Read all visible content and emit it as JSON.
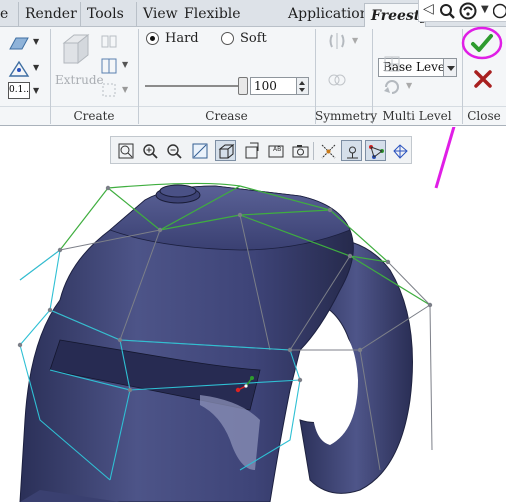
{
  "tabs": [
    {
      "label": "e"
    },
    {
      "label": "Render"
    },
    {
      "label": "Tools"
    },
    {
      "label": "View"
    },
    {
      "label": "Flexible Modeling"
    },
    {
      "label": "Applications"
    },
    {
      "label": "Freestyle"
    }
  ],
  "ribbon": {
    "extrude_label": "Extrude",
    "small_field": "0.1..",
    "hard_label": "Hard",
    "soft_label": "Soft",
    "crease_value": "100",
    "base_level": "Base Level",
    "groups": {
      "create": "Create",
      "crease": "Crease",
      "symmetry": "Symmetry",
      "multi_level": "Multi Level",
      "close": "Close"
    }
  },
  "icons": {
    "ok": "checkmark-icon",
    "cancel": "x-icon",
    "search": "search-icon",
    "help": "help-icon"
  },
  "colors": {
    "model": "#3b4170",
    "cage_green": "#3fae3f",
    "cage_cyan": "#2fc0d4",
    "annotation": "#e01ee6",
    "ok_green": "#2e9b2e",
    "cancel_red": "#a82020"
  }
}
